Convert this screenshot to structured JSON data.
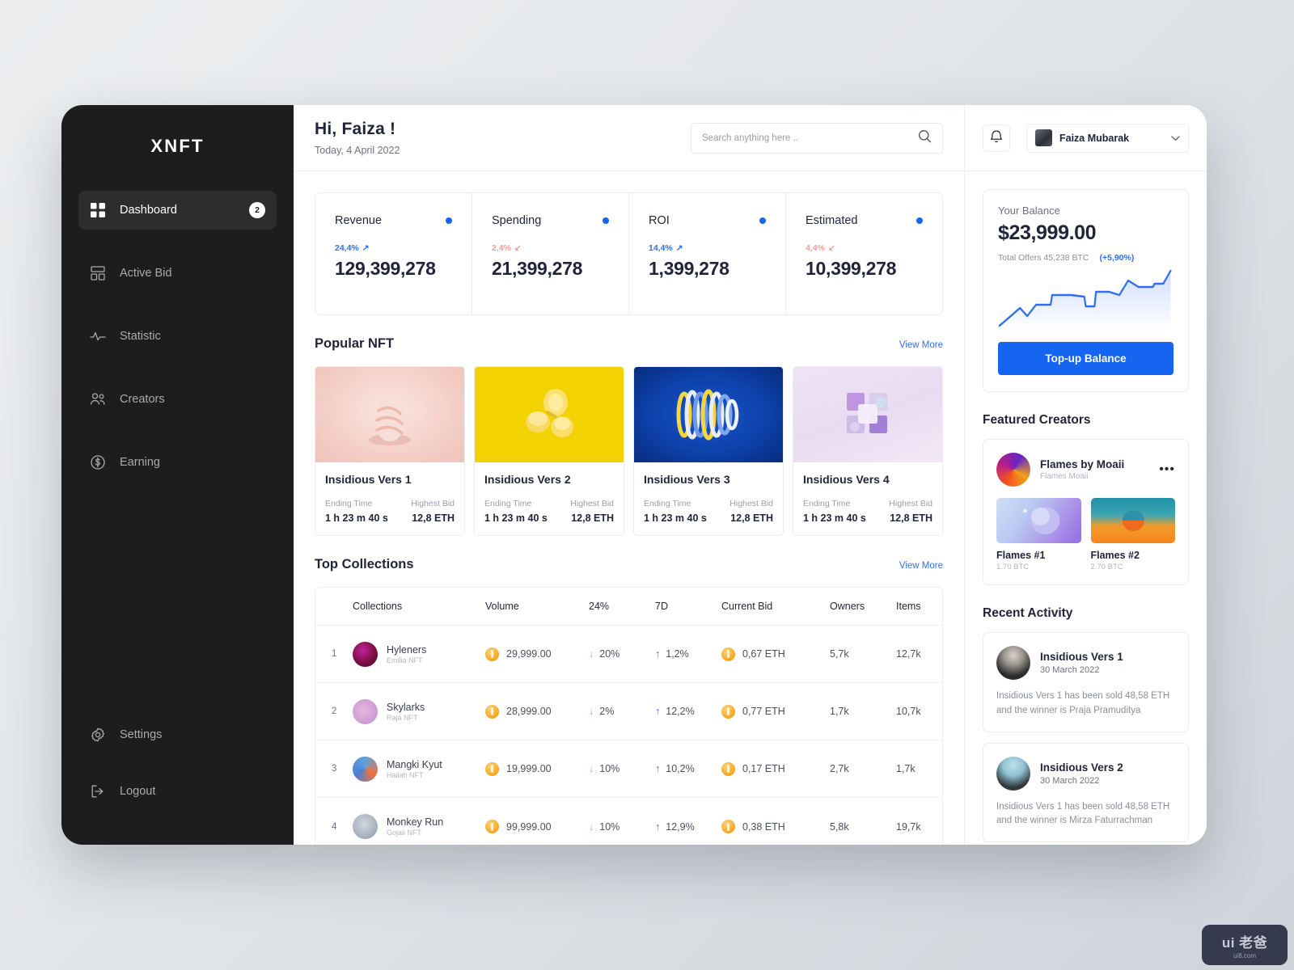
{
  "brand": "XNFT",
  "sidebar": {
    "items": [
      {
        "label": "Dashboard",
        "icon": "grid-icon",
        "badge": "2",
        "active": true
      },
      {
        "label": "Active Bid",
        "icon": "layout-icon",
        "badge": "",
        "active": false
      },
      {
        "label": "Statistic",
        "icon": "activity-icon",
        "badge": "",
        "active": false
      },
      {
        "label": "Creators",
        "icon": "users-icon",
        "badge": "",
        "active": false
      },
      {
        "label": "Earning",
        "icon": "dollar-circle-icon",
        "badge": "",
        "active": false
      }
    ],
    "bottom": [
      {
        "label": "Settings",
        "icon": "gear-icon"
      },
      {
        "label": "Logout",
        "icon": "logout-icon"
      }
    ]
  },
  "header": {
    "greeting": "Hi, Faiza !",
    "date": "Today, 4 April 2022",
    "search_placeholder": "Search anything here ..",
    "search_value": ""
  },
  "profile": {
    "name": "Faiza Mubarak"
  },
  "stats": [
    {
      "name": "Revenue",
      "delta": "24,4%",
      "direction": "up",
      "value": "129,399,278",
      "dot": "#1565f0",
      "delta_color": "#2f6df5"
    },
    {
      "name": "Spending",
      "delta": "2,4%",
      "direction": "down",
      "value": "21,399,278",
      "dot": "#1565f0",
      "delta_color": "#f79a93"
    },
    {
      "name": "ROI",
      "delta": "14,4%",
      "direction": "up",
      "value": "1,399,278",
      "dot": "#1565f0",
      "delta_color": "#2f6df5"
    },
    {
      "name": "Estimated",
      "delta": "4,4%",
      "direction": "down",
      "value": "10,399,278",
      "dot": "#1565f0",
      "delta_color": "#f79a93"
    }
  ],
  "popular": {
    "title": "Popular NFT",
    "view_more": "View More",
    "labels": {
      "ending": "Ending Time",
      "highest": "Highest Bid"
    },
    "items": [
      {
        "title": "Insidious Vers 1",
        "ending": "1 h 23 m 40 s",
        "bid": "12,8 ETH",
        "bg": "#f3cfc8"
      },
      {
        "title": "Insidious Vers 2",
        "ending": "1 h 23 m 40 s",
        "bid": "12,8 ETH",
        "bg": "#f2d200"
      },
      {
        "title": "Insidious Vers 3",
        "ending": "1 h 23 m 40 s",
        "bid": "12,8 ETH",
        "bg": "#0d41ab"
      },
      {
        "title": "Insidious Vers 4",
        "ending": "1 h 23 m 40 s",
        "bid": "12,8 ETH",
        "bg": "#ecdcf0"
      }
    ]
  },
  "collections": {
    "title": "Top Collections",
    "view_more": "View More",
    "columns": [
      "Collections",
      "Volume",
      "24%",
      "7D",
      "Current Bid",
      "Owners",
      "Items"
    ],
    "rows": [
      {
        "rank": "1",
        "name": "Hyleners",
        "sub": "Emilia NFT",
        "volume": "29,999.00",
        "d24": "20%",
        "d24_dir": "down",
        "d7": "1,2%",
        "d7_dir": "up",
        "bid": "0,67 ETH",
        "owners": "5,7k",
        "items": "12,7k",
        "avatar": "radial-gradient(circle at 40% 35%, #c421a0, #7a1040 55%, #3d0a20)"
      },
      {
        "rank": "2",
        "name": "Skylarks",
        "sub": "Raja NFT",
        "volume": "28,999.00",
        "d24": "2%",
        "d24_dir": "down",
        "d7": "12,2%",
        "d7_dir": "up",
        "bid": "0,77 ETH",
        "owners": "1,7k",
        "items": "10,7k",
        "avatar": "radial-gradient(circle at 45% 45%, #e7b6e0, #cf9fd6 60%, #b98ac8)"
      },
      {
        "rank": "3",
        "name": "Mangki Kyut",
        "sub": "Hailah NFT",
        "volume": "19,999.00",
        "d24": "10%",
        "d24_dir": "down",
        "d7": "10,2%",
        "d7_dir": "up",
        "bid": "0,17 ETH",
        "owners": "2,7k",
        "items": "1,7k",
        "avatar": "conic-gradient(from 120deg, #f0713c, #4a7fd6, #5fa3e0, #f0713c)"
      },
      {
        "rank": "4",
        "name": "Monkey Run",
        "sub": "Gojali NFT",
        "volume": "99,999.00",
        "d24": "10%",
        "d24_dir": "down",
        "d7": "12,9%",
        "d7_dir": "up",
        "bid": "0,38 ETH",
        "owners": "5,8k",
        "items": "19,7k",
        "avatar": "radial-gradient(circle at 45% 40%, #cfd6de, #a9b3bf 60%, #8c97a4)"
      }
    ]
  },
  "balance": {
    "label": "Your Balance",
    "amount": "$23,999.00",
    "offers": "Total Offers 45,238 BTC",
    "change": "(+5,90%)",
    "button": "Top-up Balance"
  },
  "featured": {
    "title": "Featured Creators",
    "creator_name": "Flames by Moaii",
    "creator_sub": "Flames Moaii",
    "menu_icon": "more-horizontal-icon",
    "works": [
      {
        "name": "Flames #1",
        "price": "1.70 BTC"
      },
      {
        "name": "Flames #2",
        "price": "2.70 BTC"
      }
    ]
  },
  "activity": {
    "title": "Recent Activity",
    "items": [
      {
        "title": "Insidious Vers 1",
        "date": "30 March 2022",
        "text": "Insidious Vers 1 has been sold 48,58 ETH and the winner is Praja Pramuditya"
      },
      {
        "title": "Insidious Vers 2",
        "date": "30 March 2022",
        "text": "Insidious Vers 1 has been sold 48,58 ETH and the winner is Mirza Faturrachman"
      }
    ]
  },
  "watermark": {
    "main": "ui 老爸",
    "sub": "ui8.com"
  }
}
